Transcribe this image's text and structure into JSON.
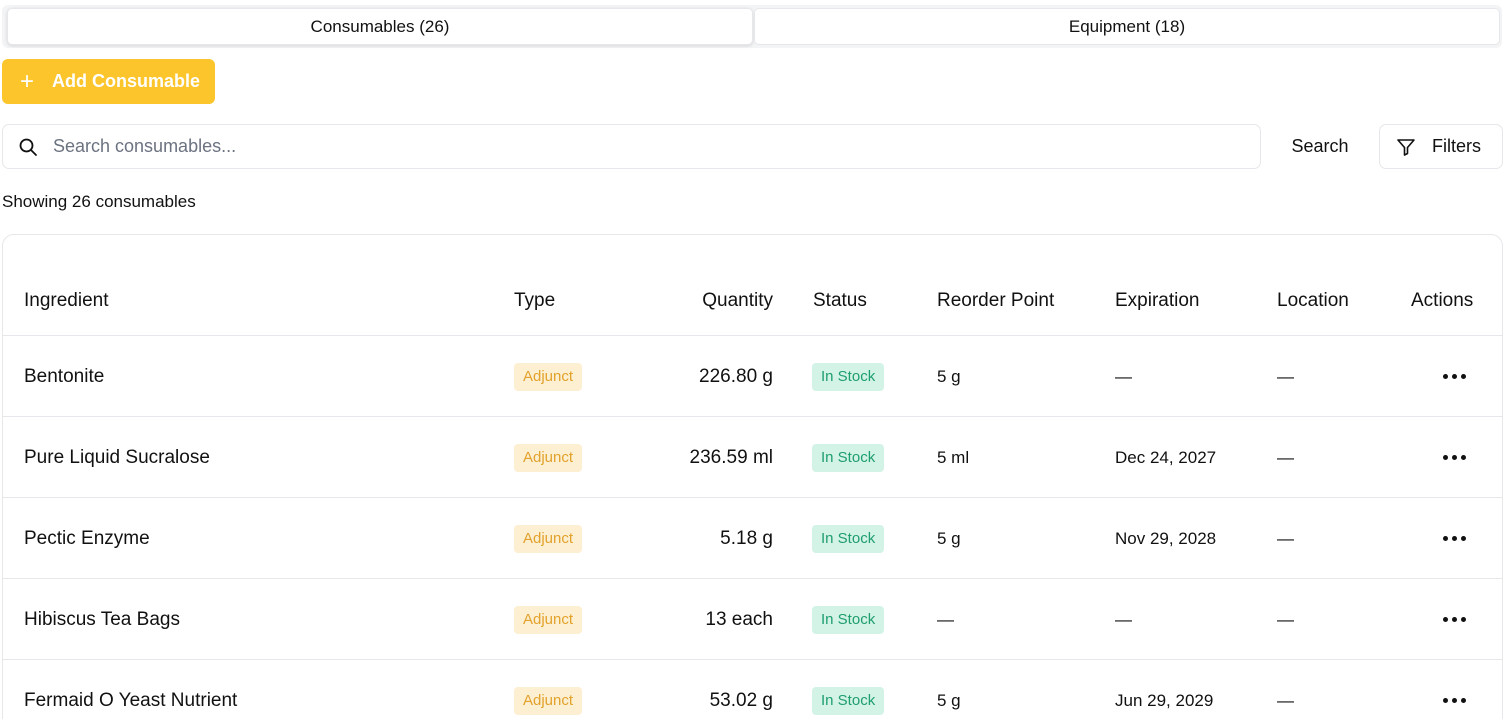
{
  "tabs": [
    {
      "label": "Consumables (26)",
      "active": true
    },
    {
      "label": "Equipment (18)",
      "active": false
    }
  ],
  "add_button": {
    "label": "Add Consumable",
    "icon": "plus-icon",
    "color": "#fbc52b"
  },
  "search": {
    "placeholder": "Search consumables...",
    "value": "",
    "icon": "search-icon",
    "button_label": "Search"
  },
  "filters": {
    "label": "Filters",
    "icon": "filter-icon"
  },
  "results_text": "Showing 26 consumables",
  "table": {
    "columns": [
      "Ingredient",
      "Type",
      "Quantity",
      "Status",
      "Reorder Point",
      "Expiration",
      "Location",
      "Actions"
    ],
    "rows": [
      {
        "name": "Bentonite",
        "type": "Adjunct",
        "quantity": "226.80 g",
        "status": "In Stock",
        "reorder": "5 g",
        "expiration": "—",
        "location": "—"
      },
      {
        "name": "Pure Liquid Sucralose",
        "type": "Adjunct",
        "quantity": "236.59 ml",
        "status": "In Stock",
        "reorder": "5 ml",
        "expiration": "Dec 24, 2027",
        "location": "—"
      },
      {
        "name": "Pectic Enzyme",
        "type": "Adjunct",
        "quantity": "5.18 g",
        "status": "In Stock",
        "reorder": "5 g",
        "expiration": "Nov 29, 2028",
        "location": "—"
      },
      {
        "name": "Hibiscus Tea Bags",
        "type": "Adjunct",
        "quantity": "13 each",
        "status": "In Stock",
        "reorder": "—",
        "expiration": "—",
        "location": "—"
      },
      {
        "name": "Fermaid O Yeast Nutrient",
        "type": "Adjunct",
        "quantity": "53.02 g",
        "status": "In Stock",
        "reorder": "5 g",
        "expiration": "Jun 29, 2029",
        "location": "—"
      }
    ]
  },
  "colors": {
    "accent": "#fbc52b",
    "type_badge_bg": "#fdefd2",
    "type_badge_text": "#e2a22b",
    "status_badge_bg": "#d2f3e6",
    "status_badge_text": "#1f9e6e"
  }
}
